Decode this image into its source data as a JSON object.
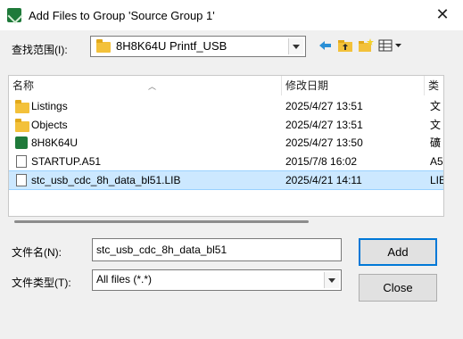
{
  "window": {
    "title": "Add Files to Group 'Source Group 1'"
  },
  "lookin": {
    "label": "查找范围(I):",
    "value": "8H8K64U Printf_USB"
  },
  "toolbar": {
    "icons": [
      "back-icon",
      "up-folder-icon",
      "new-folder-icon",
      "view-menu-icon"
    ]
  },
  "list": {
    "columns": [
      {
        "label": "名称"
      },
      {
        "label": "修改日期"
      },
      {
        "label": "类"
      }
    ],
    "rows": [
      {
        "name": "Listings",
        "date": "2025/4/27 13:51",
        "type": "文",
        "icon": "folder-icon"
      },
      {
        "name": "Objects",
        "date": "2025/4/27 13:51",
        "type": "文",
        "icon": "folder-icon"
      },
      {
        "name": "8H8K64U",
        "date": "2025/4/27 13:50",
        "type": "礦",
        "icon": "project-icon"
      },
      {
        "name": "STARTUP.A51",
        "date": "2015/7/8 16:02",
        "type": "A5",
        "icon": "file-icon"
      },
      {
        "name": "stc_usb_cdc_8h_data_bl51.LIB",
        "date": "2025/4/21 14:11",
        "type": "LIE",
        "icon": "file-icon",
        "selected": true
      }
    ]
  },
  "filename": {
    "label": "文件名(N):",
    "value": "stc_usb_cdc_8h_data_bl51"
  },
  "filetype": {
    "label": "文件类型(T):",
    "value": "All files (*.*)"
  },
  "buttons": {
    "add": "Add",
    "close": "Close"
  },
  "colors": {
    "accent": "#0078d7",
    "selection": "#cce8ff",
    "folder": "#f3c13a"
  }
}
